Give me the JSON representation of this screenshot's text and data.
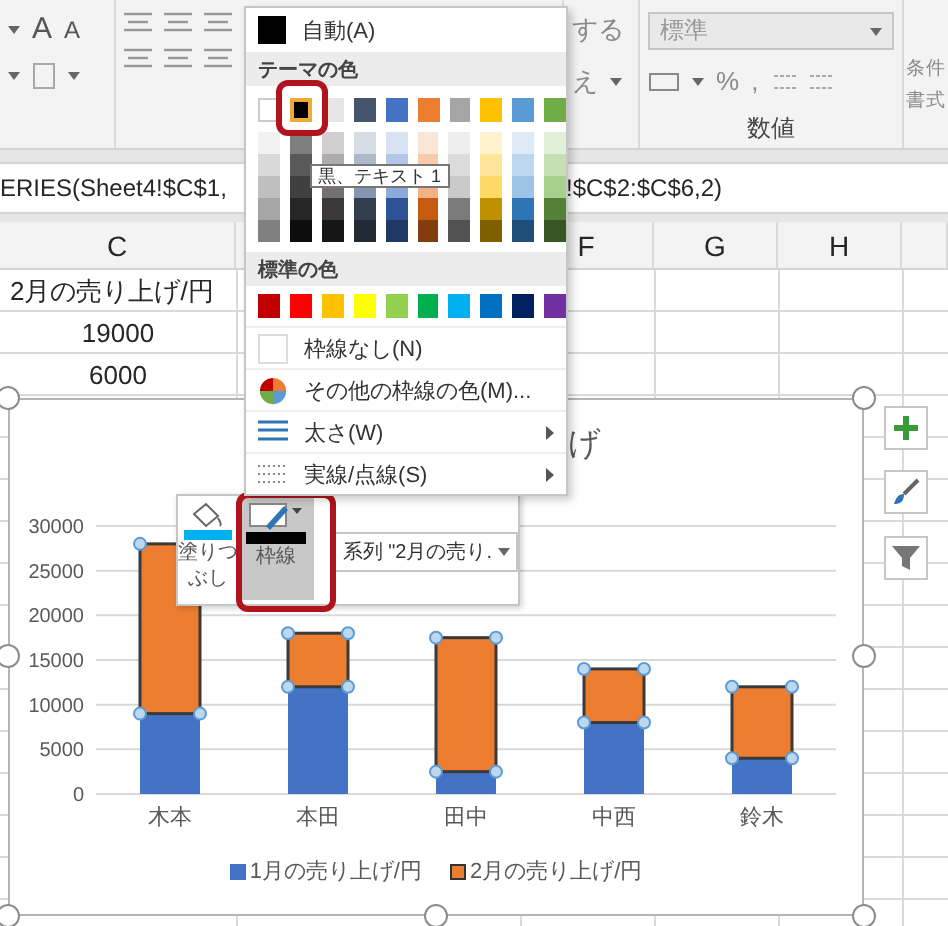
{
  "ribbon": {
    "font_buttons": [
      "A",
      "A"
    ],
    "wrap_text": "する",
    "merge": "え",
    "number_format": "標準",
    "percent": "%",
    "comma": ",",
    "number_group": "数値",
    "conditional": [
      "条件",
      "書式"
    ]
  },
  "formula_bar": {
    "left": "ERIES(Sheet4!$C$1,",
    "right": "!$C$2:$C$6,2)"
  },
  "columns": [
    {
      "label": "C"
    },
    {
      "label": "F"
    },
    {
      "label": "G"
    },
    {
      "label": "H"
    }
  ],
  "cells": [
    {
      "text": "2月の売り上げ/円",
      "kind": "text"
    },
    {
      "text": "19000",
      "kind": "number"
    },
    {
      "text": "6000",
      "kind": "number"
    }
  ],
  "chart": {
    "title": "げ",
    "series_state": [
      {
        "selected": false
      },
      {
        "selected": true
      }
    ],
    "chart_data": {
      "type": "bar",
      "stacked": true,
      "grid": true,
      "categories": [
        "木本",
        "本田",
        "田中",
        "中西",
        "鈴木"
      ],
      "ylim": [
        0,
        30000
      ],
      "yticks": [
        0,
        5000,
        10000,
        15000,
        20000,
        25000,
        30000
      ],
      "series": [
        {
          "name": "1月の売り上げ/円",
          "color": "#4472c4",
          "values": [
            9000,
            12000,
            2500,
            8000,
            4000
          ]
        },
        {
          "name": "2月の売り上げ/円",
          "color": "#ed7d31",
          "values": [
            19000,
            6000,
            15000,
            6000,
            8000
          ]
        }
      ]
    }
  },
  "mini_toolbar": {
    "buttons": [
      {
        "kind": "fill",
        "lines": [
          "塗りつ",
          "ぶし"
        ],
        "selected": false
      },
      {
        "kind": "outline",
        "lines": [
          "枠線"
        ],
        "selected": true
      }
    ],
    "series_dropdown": "系列 \"2月の売り."
  },
  "color_menu": {
    "auto": {
      "label": "自動(A)",
      "color": "#000000"
    },
    "theme_header": "テーマの色",
    "theme_rows": [
      {
        "swatches": [
          {
            "color": "#ffffff",
            "selected": false
          },
          {
            "color": "#000000",
            "selected": true
          },
          {
            "color": "#e7e6e6",
            "selected": false
          },
          {
            "color": "#44546a",
            "selected": false
          },
          {
            "color": "#4472c4",
            "selected": false
          },
          {
            "color": "#ed7d31",
            "selected": false
          },
          {
            "color": "#a5a5a5",
            "selected": false
          },
          {
            "color": "#ffc000",
            "selected": false
          },
          {
            "color": "#5b9bd5",
            "selected": false
          },
          {
            "color": "#70ad47",
            "selected": false
          }
        ]
      },
      {
        "swatches": [
          {
            "color": "#f2f2f2",
            "selected": false
          },
          {
            "color": "#7f7f7f",
            "selected": false
          },
          {
            "color": "#d0cece",
            "selected": false
          },
          {
            "color": "#d6dce4",
            "selected": false
          },
          {
            "color": "#d9e2f3",
            "selected": false
          },
          {
            "color": "#fbe5d5",
            "selected": false
          },
          {
            "color": "#ededed",
            "selected": false
          },
          {
            "color": "#fff2cc",
            "selected": false
          },
          {
            "color": "#deebf6",
            "selected": false
          },
          {
            "color": "#e2efd9",
            "selected": false
          }
        ]
      },
      {
        "swatches": [
          {
            "color": "#d9d9d9",
            "selected": false
          },
          {
            "color": "#595959",
            "selected": false
          },
          {
            "color": "#aeabab",
            "selected": false
          },
          {
            "color": "#adb9ca",
            "selected": false
          },
          {
            "color": "#b4c6e7",
            "selected": false
          },
          {
            "color": "#f7cbac",
            "selected": false
          },
          {
            "color": "#dbdbdb",
            "selected": false
          },
          {
            "color": "#fee599",
            "selected": false
          },
          {
            "color": "#bdd7ee",
            "selected": false
          },
          {
            "color": "#c5e0b3",
            "selected": false
          }
        ]
      },
      {
        "swatches": [
          {
            "color": "#bfbfbf",
            "selected": false
          },
          {
            "color": "#404040",
            "selected": false
          },
          {
            "color": "#757171",
            "selected": false
          },
          {
            "color": "#8496b0",
            "selected": false
          },
          {
            "color": "#8eaadb",
            "selected": false
          },
          {
            "color": "#f4b183",
            "selected": false
          },
          {
            "color": "#c9c9c9",
            "selected": false
          },
          {
            "color": "#ffd965",
            "selected": false
          },
          {
            "color": "#9dc3e6",
            "selected": false
          },
          {
            "color": "#a8d08d",
            "selected": false
          }
        ]
      },
      {
        "swatches": [
          {
            "color": "#a6a6a6",
            "selected": false
          },
          {
            "color": "#262626",
            "selected": false
          },
          {
            "color": "#3a3838",
            "selected": false
          },
          {
            "color": "#333f4f",
            "selected": false
          },
          {
            "color": "#2f5496",
            "selected": false
          },
          {
            "color": "#c55a11",
            "selected": false
          },
          {
            "color": "#7b7b7b",
            "selected": false
          },
          {
            "color": "#bf9000",
            "selected": false
          },
          {
            "color": "#2e75b5",
            "selected": false
          },
          {
            "color": "#538135",
            "selected": false
          }
        ]
      },
      {
        "swatches": [
          {
            "color": "#808080",
            "selected": false
          },
          {
            "color": "#0d0d0d",
            "selected": false
          },
          {
            "color": "#171616",
            "selected": false
          },
          {
            "color": "#222a35",
            "selected": false
          },
          {
            "color": "#1f3864",
            "selected": false
          },
          {
            "color": "#833c0b",
            "selected": false
          },
          {
            "color": "#525252",
            "selected": false
          },
          {
            "color": "#7f6000",
            "selected": false
          },
          {
            "color": "#1e4e79",
            "selected": false
          },
          {
            "color": "#375623",
            "selected": false
          }
        ]
      }
    ],
    "tooltip": "黒、テキスト 1",
    "standard_header": "標準の色",
    "standard": [
      {
        "color": "#c00000",
        "selected": false
      },
      {
        "color": "#ff0000",
        "selected": false
      },
      {
        "color": "#ffc000",
        "selected": false
      },
      {
        "color": "#ffff00",
        "selected": false
      },
      {
        "color": "#92d050",
        "selected": false
      },
      {
        "color": "#00b050",
        "selected": false
      },
      {
        "color": "#00b0f0",
        "selected": false
      },
      {
        "color": "#0070c0",
        "selected": false
      },
      {
        "color": "#002060",
        "selected": false
      },
      {
        "color": "#7030a0",
        "selected": false
      }
    ],
    "items": [
      {
        "kind": "none",
        "label": "枠線なし(N)",
        "submenu": false
      },
      {
        "kind": "more",
        "label": "その他の枠線の色(M)...",
        "submenu": false
      },
      {
        "kind": "weight",
        "label": "太さ(W)",
        "submenu": true
      },
      {
        "kind": "dash",
        "label": "実線/点線(S)",
        "submenu": true
      }
    ]
  }
}
